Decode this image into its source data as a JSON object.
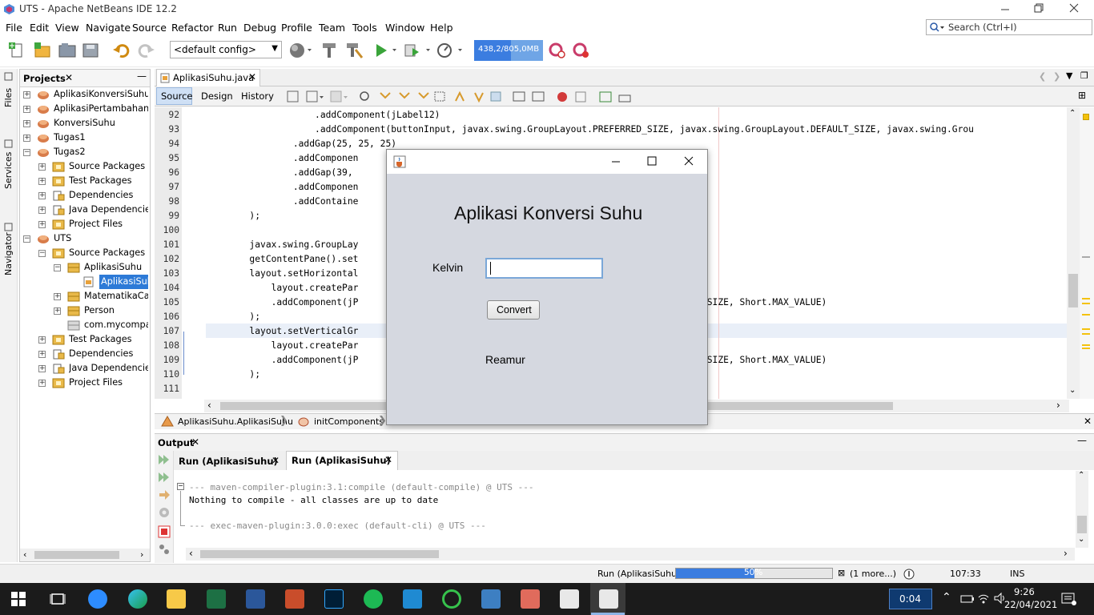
{
  "window": {
    "title": "UTS - Apache NetBeans IDE 12.2"
  },
  "menu": [
    "File",
    "Edit",
    "View",
    "Navigate",
    "Source",
    "Refactor",
    "Run",
    "Debug",
    "Profile",
    "Team",
    "Tools",
    "Window",
    "Help"
  ],
  "search": {
    "placeholder": "Search (Ctrl+I)"
  },
  "toolbar": {
    "config": "<default config>",
    "memory": "438,2/805,0MB"
  },
  "sidebar_tabs": [
    "Files",
    "Services",
    "Navigator"
  ],
  "projects": {
    "title": "Projects",
    "items": [
      {
        "label": "AplikasiKonversiSuhu"
      },
      {
        "label": "AplikasiPertambahanDua"
      },
      {
        "label": "KonversiSuhu"
      },
      {
        "label": "Tugas1"
      },
      {
        "label": "Tugas2"
      },
      {
        "label": "Source Packages"
      },
      {
        "label": "Test Packages"
      },
      {
        "label": "Dependencies"
      },
      {
        "label": "Java Dependencies"
      },
      {
        "label": "Project Files"
      },
      {
        "label": "UTS"
      },
      {
        "label": "Source Packages"
      },
      {
        "label": "AplikasiSuhu"
      },
      {
        "label": "AplikasiSuhu.java"
      },
      {
        "label": "MatematikaCanggih"
      },
      {
        "label": "Person"
      },
      {
        "label": "com.mycompany"
      },
      {
        "label": "Test Packages"
      },
      {
        "label": "Dependencies"
      },
      {
        "label": "Java Dependencies"
      },
      {
        "label": "Project Files"
      }
    ]
  },
  "editor": {
    "tab": "AplikasiSuhu.java",
    "views": [
      "Source",
      "Design",
      "History"
    ],
    "lines": [
      {
        "n": "92",
        "code": "                    .addComponent(jLabel12)"
      },
      {
        "n": "93",
        "code": "                    .addComponent(buttonInput, javax.swing.GroupLayout.PREFERRED_SIZE, javax.swing.GroupLayout.DEFAULT_SIZE, javax.swing.Grou"
      },
      {
        "n": "94",
        "code": "                .addGap(25, 25, 25)"
      },
      {
        "n": "95",
        "code": "                .addComponen"
      },
      {
        "n": "96",
        "code": "                .addGap(39,"
      },
      {
        "n": "97",
        "code": "                .addComponen"
      },
      {
        "n": "98",
        "code": "                .addContaine"
      },
      {
        "n": "99",
        "code": "        );"
      },
      {
        "n": "100",
        "code": ""
      },
      {
        "n": "101",
        "code": "        javax.swing.GroupLay                                     tPane());"
      },
      {
        "n": "102",
        "code": "        getContentPane().set"
      },
      {
        "n": "103",
        "code": "        layout.setHorizontal"
      },
      {
        "n": "104",
        "code": "            layout.createPar                                     NG)"
      },
      {
        "n": "105",
        "code": "            .addComponent(jP                                     .swing.GroupLayout.DEFAULT_SIZE, Short.MAX_VALUE)"
      },
      {
        "n": "106",
        "code": "        );"
      },
      {
        "n": "107",
        "code": "        layout.setVerticalGr"
      },
      {
        "n": "108",
        "code": "            layout.createPar                                     NG)"
      },
      {
        "n": "109",
        "code": "            .addComponent(jP                                     .swing.GroupLayout.DEFAULT_SIZE, Short.MAX_VALUE)"
      },
      {
        "n": "110",
        "code": "        );"
      },
      {
        "n": "111",
        "code": ""
      }
    ],
    "breadcrumb": [
      "AplikasiSuhu.AplikasiSuhu",
      "initComponents"
    ]
  },
  "output": {
    "title": "Output",
    "tabs": [
      "Run (AplikasiSuhu)",
      "Run (AplikasiSuhu)"
    ],
    "lines": [
      "--- maven-compiler-plugin:3.1:compile (default-compile) @ UTS ---",
      "Nothing to compile - all classes are up to date",
      "",
      "--- exec-maven-plugin:3.0.0:exec (default-cli) @ UTS ---"
    ]
  },
  "status": {
    "task": "Run (AplikasiSuhu)",
    "progress": "50%",
    "progress_value": 0.5,
    "more": "(1 more...)",
    "position": "107:33",
    "mode": "INS"
  },
  "dialog": {
    "heading": "Aplikasi Konversi Suhu",
    "kelvin_label": "Kelvin",
    "kelvin_value": "",
    "button": "Convert",
    "result_label": "Reamur"
  },
  "taskbar": {
    "timer": "0:04",
    "time": "9:26",
    "date": "22/04/2021"
  },
  "colors": {
    "accent": "#3b7de0",
    "selected": "#2d7ad7",
    "string": "#2e9b2e",
    "taskbar": "#1b1b1b"
  }
}
